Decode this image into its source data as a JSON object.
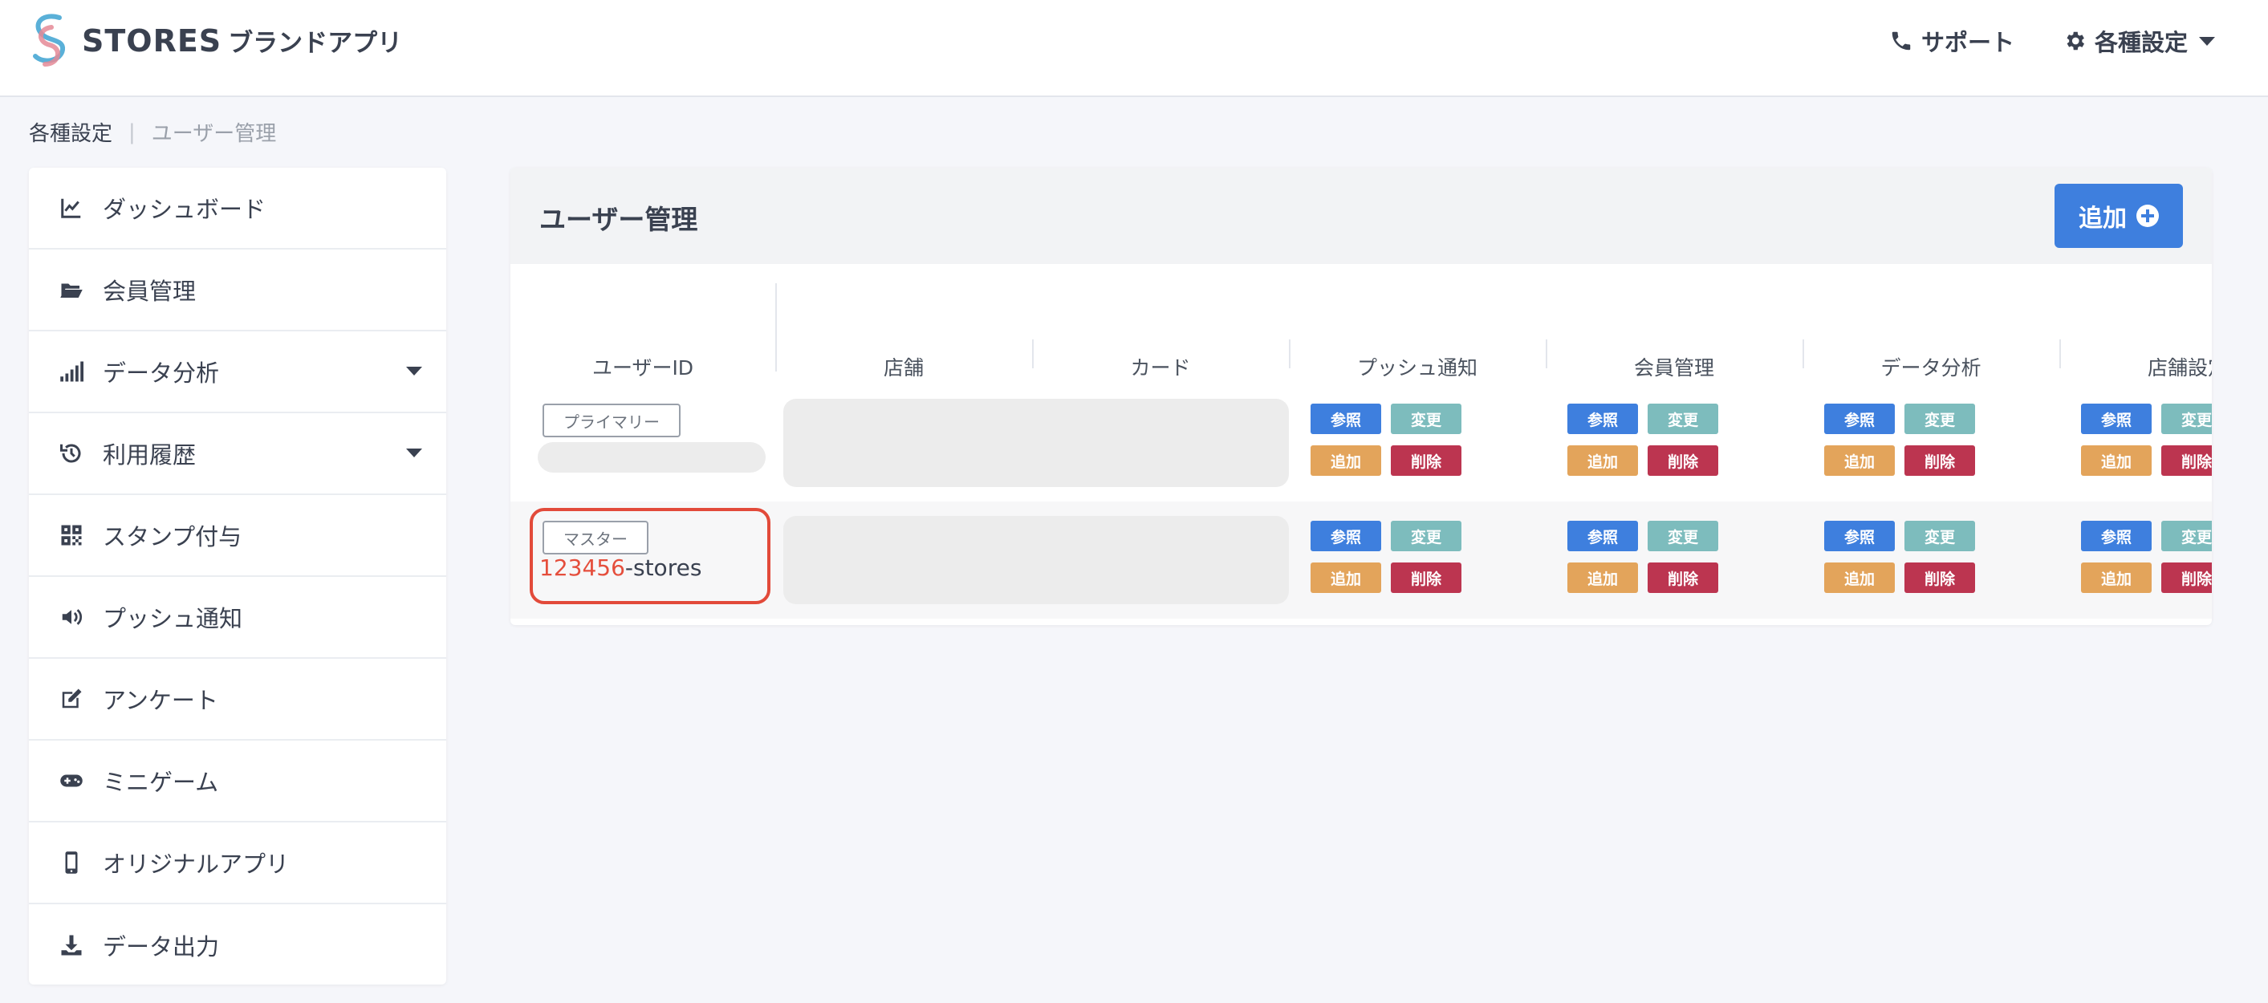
{
  "header": {
    "brand": "STORES",
    "brand_sub": "ブランドアプリ",
    "support_label": "サポート",
    "settings_label": "各種設定"
  },
  "breadcrumb": {
    "parent": "各種設定",
    "current": "ユーザー管理"
  },
  "sidebar": {
    "items": [
      {
        "label": "ダッシュボード",
        "icon": "chart-line-icon"
      },
      {
        "label": "会員管理",
        "icon": "folder-open-icon"
      },
      {
        "label": "データ分析",
        "icon": "signal-bars-icon",
        "expandable": true
      },
      {
        "label": "利用履歴",
        "icon": "history-icon",
        "expandable": true
      },
      {
        "label": "スタンプ付与",
        "icon": "qr-code-icon"
      },
      {
        "label": "プッシュ通知",
        "icon": "volume-icon"
      },
      {
        "label": "アンケート",
        "icon": "edit-icon"
      },
      {
        "label": "ミニゲーム",
        "icon": "gamepad-icon"
      },
      {
        "label": "オリジナルアプリ",
        "icon": "mobile-icon"
      },
      {
        "label": "データ出力",
        "icon": "download-icon"
      }
    ]
  },
  "main": {
    "title": "ユーザー管理",
    "add_label": "追加",
    "columns": [
      "ユーザーID",
      "店舗",
      "カード",
      "プッシュ通知",
      "会員管理",
      "データ分析",
      "店舗設定"
    ],
    "perm_labels": {
      "view": "参照",
      "change": "変更",
      "add": "追加",
      "delete": "削除"
    },
    "rows": [
      {
        "role": "プライマリー",
        "user_id": ""
      },
      {
        "role": "マスター",
        "user_id_number": "123456",
        "user_id_suffix": "-stores"
      }
    ]
  },
  "colors": {
    "accent": "#3e7fde",
    "view": "#3e7fde",
    "change": "#7dbcbd",
    "add": "#e3a45b",
    "delete": "#bc3550",
    "highlight": "#e24a3a"
  }
}
